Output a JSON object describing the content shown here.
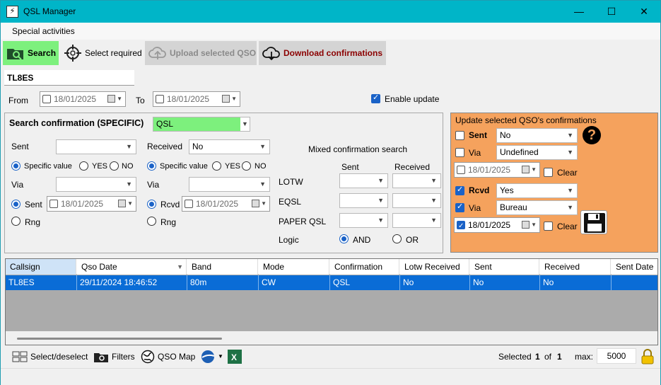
{
  "window": {
    "title": "QSL Manager",
    "minimize": "—",
    "maximize": "☐",
    "close": "✕"
  },
  "menu": {
    "special": "Special activities"
  },
  "toolbar": {
    "search": "Search",
    "select_required": "Select required",
    "upload": "Upload selected QSO",
    "download": "Download confirmations"
  },
  "callsign_value": "TL8ES",
  "from_label": "From",
  "to_label": "To",
  "from_date": "18/01/2025",
  "to_date": "18/01/2025",
  "enable_update": "Enable update",
  "search_confirmation": {
    "title": "Search confirmation (SPECIFIC)",
    "type_value": "QSL",
    "sent_label": "Sent",
    "sent_value": "",
    "received_label": "Received",
    "received_value": "No",
    "specific_value": "Specific value",
    "yes": "YES",
    "no": "NO",
    "via_label": "Via",
    "sent_date_label": "Sent",
    "rcvd_date_label": "Rcvd",
    "sent_date": "18/01/2025",
    "rcvd_date": "18/01/2025",
    "rng": "Rng"
  },
  "mixed": {
    "title": "Mixed confirmation search",
    "sent_col": "Sent",
    "received_col": "Received",
    "lotw": "LOTW",
    "eqsl": "EQSL",
    "paper": "PAPER QSL",
    "logic": "Logic",
    "and": "AND",
    "or": "OR"
  },
  "update_panel": {
    "title": "Update selected QSO's confirmations",
    "sent_label": "Sent",
    "sent_value": "No",
    "via_label": "Via",
    "via_value": "Undefined",
    "date1": "18/01/2025",
    "clear": "Clear",
    "rcvd_label": "Rcvd",
    "rcvd_value": "Yes",
    "via2_label": "Via",
    "via2_value": "Bureau",
    "date2": "18/01/2025",
    "clear2": "Clear"
  },
  "grid": {
    "columns": [
      "Callsign",
      "Qso Date",
      "Band",
      "Mode",
      "Confirmation",
      "Lotw Received",
      "Sent",
      "Received",
      "Sent Date"
    ],
    "rows": [
      [
        "TL8ES",
        "29/11/2024 18:46:52",
        "80m",
        "CW",
        "QSL",
        "No",
        "No",
        "No",
        ""
      ]
    ]
  },
  "statusbar": {
    "select_deselect": "Select/deselect",
    "filters": "Filters",
    "qso_map": "QSO Map",
    "selected_label": "Selected",
    "selected_count": "1",
    "of_label": "of",
    "total": "1",
    "max_label": "max:",
    "max_value": "5000"
  },
  "colors": {
    "titlebar": "#00b5c8",
    "search_green": "#7df07d",
    "update_orange": "#f5a25d",
    "selection_blue": "#0a6cd6"
  }
}
